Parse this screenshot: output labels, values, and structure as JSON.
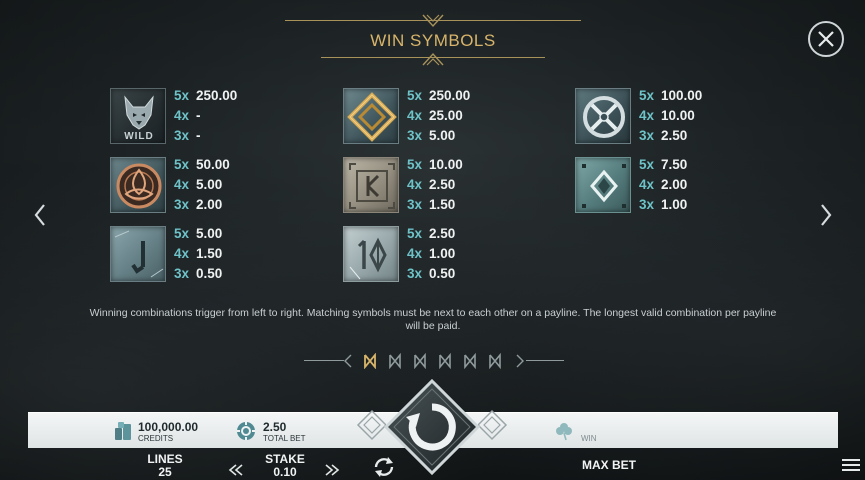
{
  "page": {
    "title": "WIN SYMBOLS",
    "rules_text": "Winning combinations trigger from left to right. Matching symbols must be next to each other on a payline. The longest valid combination per payline will be paid."
  },
  "symbols": [
    {
      "icon": "wolf-wild-symbol",
      "tile_label": "WILD",
      "pays": [
        {
          "mult": "5x",
          "value": "250.00"
        },
        {
          "mult": "4x",
          "value": "-"
        },
        {
          "mult": "3x",
          "value": "-"
        }
      ]
    },
    {
      "icon": "gold-diamond-knot-symbol",
      "pays": [
        {
          "mult": "5x",
          "value": "250.00"
        },
        {
          "mult": "4x",
          "value": "25.00"
        },
        {
          "mult": "3x",
          "value": "5.00"
        }
      ]
    },
    {
      "icon": "silver-circle-cross-symbol",
      "pays": [
        {
          "mult": "5x",
          "value": "100.00"
        },
        {
          "mult": "4x",
          "value": "10.00"
        },
        {
          "mult": "3x",
          "value": "2.50"
        }
      ]
    },
    {
      "icon": "bronze-triquetra-symbol",
      "pays": [
        {
          "mult": "5x",
          "value": "50.00"
        },
        {
          "mult": "4x",
          "value": "5.00"
        },
        {
          "mult": "3x",
          "value": "2.00"
        }
      ]
    },
    {
      "icon": "stone-rune-k-symbol",
      "pays": [
        {
          "mult": "5x",
          "value": "10.00"
        },
        {
          "mult": "4x",
          "value": "2.50"
        },
        {
          "mult": "3x",
          "value": "1.50"
        }
      ]
    },
    {
      "icon": "stone-diamond-symbol",
      "pays": [
        {
          "mult": "5x",
          "value": "7.50"
        },
        {
          "mult": "4x",
          "value": "2.00"
        },
        {
          "mult": "3x",
          "value": "1.00"
        }
      ]
    },
    {
      "icon": "stone-rune-j-symbol",
      "pays": [
        {
          "mult": "5x",
          "value": "5.00"
        },
        {
          "mult": "4x",
          "value": "1.50"
        },
        {
          "mult": "3x",
          "value": "0.50"
        }
      ]
    },
    {
      "icon": "stone-rune-10-symbol",
      "pays": [
        {
          "mult": "5x",
          "value": "2.50"
        },
        {
          "mult": "4x",
          "value": "1.00"
        },
        {
          "mult": "3x",
          "value": "0.50"
        }
      ]
    }
  ],
  "pager": {
    "pages": 6,
    "current": 1
  },
  "bar": {
    "credits_value": "100,000.00",
    "credits_label": "CREDITS",
    "total_bet_value": "2.50",
    "total_bet_label": "TOTAL BET",
    "win_label": "WIN"
  },
  "controls": {
    "lines_label": "LINES",
    "lines_value": "25",
    "stake_label": "STAKE",
    "stake_value": "0.10",
    "max_bet_label": "MAX BET"
  },
  "colors": {
    "title_gold": "#d8b46a",
    "multiplier_teal": "#6ec3c9",
    "bar_background": "#eef1f1"
  },
  "icons": [
    "close-icon",
    "chevron-left-icon",
    "chevron-right-icon",
    "spin-icon",
    "autoplay-icon",
    "menu-icon",
    "coin-stack-icon",
    "chip-icon",
    "clover-icon"
  ]
}
